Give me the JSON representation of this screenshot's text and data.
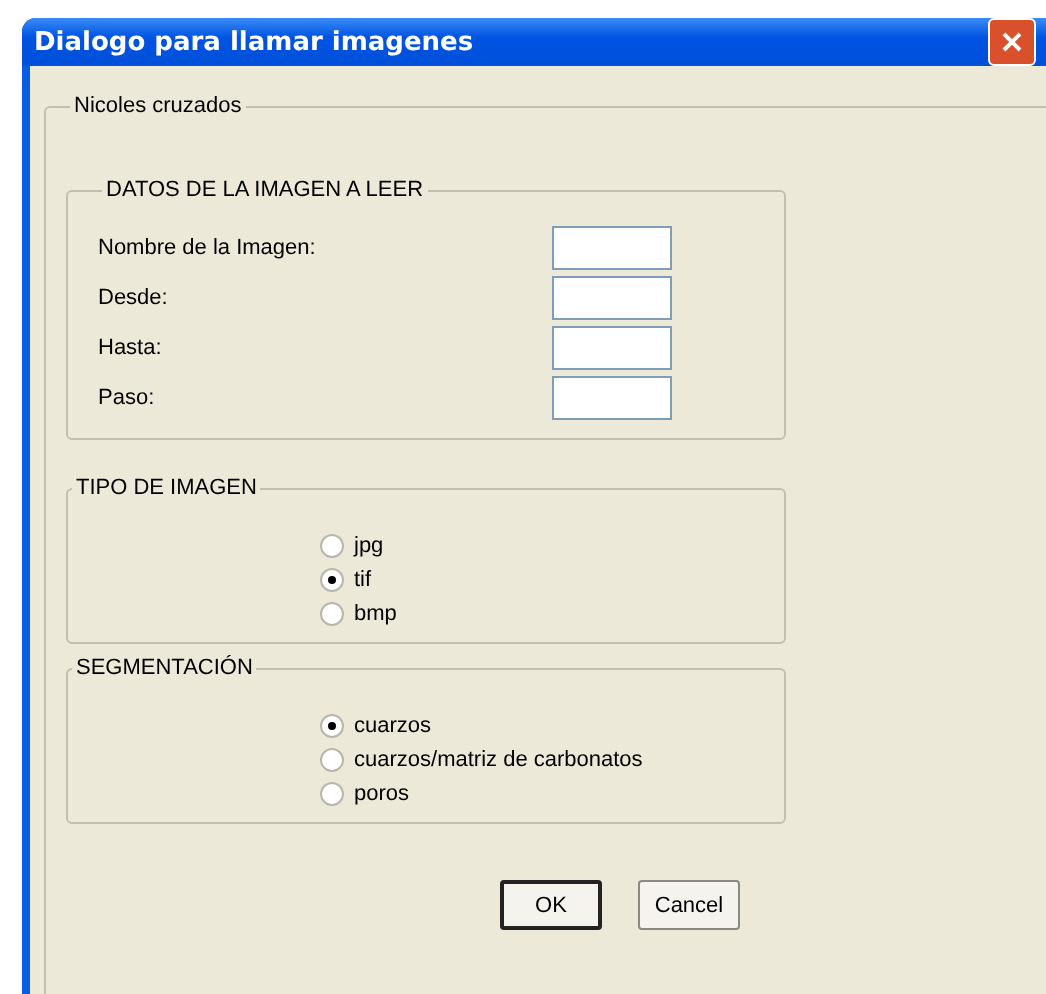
{
  "window": {
    "title": "Dialogo para llamar imagenes"
  },
  "outer_group": {
    "title": "Nicoles cruzados"
  },
  "image_data": {
    "title": "DATOS DE LA IMAGEN A LEER",
    "fields": [
      {
        "label": "Nombre de la Imagen:"
      },
      {
        "label": "Desde:"
      },
      {
        "label": "Hasta:"
      },
      {
        "label": "Paso:"
      }
    ]
  },
  "image_type": {
    "title": "TIPO DE IMAGEN",
    "options": [
      {
        "label": "jpg",
        "selected": false
      },
      {
        "label": "tif",
        "selected": true
      },
      {
        "label": "bmp",
        "selected": false
      }
    ]
  },
  "segmentation": {
    "title": "SEGMENTACIÓN",
    "options": [
      {
        "label": "cuarzos",
        "selected": true
      },
      {
        "label": "cuarzos/matriz de carbonatos",
        "selected": false
      },
      {
        "label": "poros",
        "selected": false
      }
    ]
  },
  "buttons": [
    {
      "label": "OK",
      "default": true
    },
    {
      "label": "Cancel",
      "default": false
    }
  ]
}
